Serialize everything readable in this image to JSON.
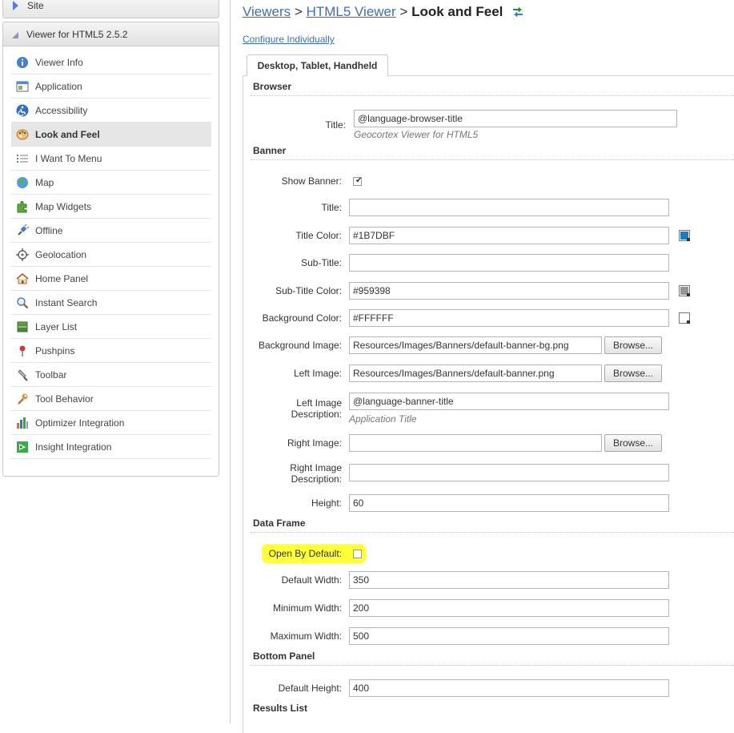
{
  "sidebar": {
    "site_label": "Site",
    "viewer_label": "Viewer for HTML5 2.5.2",
    "items": [
      {
        "label": "Viewer Info",
        "icon": "info-icon"
      },
      {
        "label": "Application",
        "icon": "application-icon"
      },
      {
        "label": "Accessibility",
        "icon": "accessibility-icon"
      },
      {
        "label": "Look and Feel",
        "icon": "palette-icon",
        "active": true
      },
      {
        "label": "I Want To Menu",
        "icon": "menu-list-icon"
      },
      {
        "label": "Map",
        "icon": "globe-icon"
      },
      {
        "label": "Map Widgets",
        "icon": "puzzle-icon"
      },
      {
        "label": "Offline",
        "icon": "plug-icon"
      },
      {
        "label": "Geolocation",
        "icon": "crosshair-icon"
      },
      {
        "label": "Home Panel",
        "icon": "home-icon"
      },
      {
        "label": "Instant Search",
        "icon": "magnifier-icon"
      },
      {
        "label": "Layer List",
        "icon": "layers-icon"
      },
      {
        "label": "Pushpins",
        "icon": "pushpin-icon"
      },
      {
        "label": "Toolbar",
        "icon": "toolbar-icon"
      },
      {
        "label": "Tool Behavior",
        "icon": "wrench-icon"
      },
      {
        "label": "Optimizer Integration",
        "icon": "bar-chart-icon"
      },
      {
        "label": "Insight Integration",
        "icon": "insight-icon"
      }
    ]
  },
  "breadcrumb": {
    "viewers": "Viewers",
    "sep": ">",
    "html5_viewer": "HTML5 Viewer",
    "current": "Look and Feel"
  },
  "configure_link": "Configure Individually",
  "tab_label": "Desktop, Tablet, Handheld",
  "sections": {
    "browser": "Browser",
    "banner": "Banner",
    "data_frame": "Data Frame",
    "bottom_panel": "Bottom Panel",
    "results_list": "Results List"
  },
  "browser": {
    "title_label": "Title:",
    "title_value": "@language-browser-title",
    "title_hint": "Geocortex Viewer for HTML5"
  },
  "banner": {
    "show_banner_label": "Show Banner:",
    "show_banner_checked": true,
    "title_label": "Title:",
    "title_value": "",
    "title_color_label": "Title Color:",
    "title_color_value": "#1B7DBF",
    "subtitle_label": "Sub-Title:",
    "subtitle_value": "",
    "subtitle_color_label": "Sub-Title Color:",
    "subtitle_color_value": "#959398",
    "bg_color_label": "Background Color:",
    "bg_color_value": "#FFFFFF",
    "bg_image_label": "Background Image:",
    "bg_image_value": "Resources/Images/Banners/default-banner-bg.png",
    "left_image_label": "Left Image:",
    "left_image_value": "Resources/Images/Banners/default-banner.png",
    "left_desc_label_1": "Left Image",
    "left_desc_label_2": "Description:",
    "left_desc_value": "@language-banner-title",
    "left_desc_hint": "Application Title",
    "right_image_label": "Right Image:",
    "right_image_value": "",
    "right_desc_label_1": "Right Image",
    "right_desc_label_2": "Description:",
    "right_desc_value": "",
    "height_label": "Height:",
    "height_value": "60",
    "browse_label": "Browse..."
  },
  "data_frame": {
    "open_default_label": "Open By Default:",
    "open_default_checked": false,
    "default_width_label": "Default Width:",
    "default_width_value": "350",
    "min_width_label": "Minimum Width:",
    "min_width_value": "200",
    "max_width_label": "Maximum Width:",
    "max_width_value": "500"
  },
  "bottom_panel": {
    "default_height_label": "Default Height:",
    "default_height_value": "400"
  },
  "colors": {
    "link": "#3d6fb8",
    "title_swatch": "#1B7DBF",
    "subtitle_swatch": "#959398",
    "bg_swatch": "#FFFFFF",
    "highlight": "#ffff3a"
  }
}
